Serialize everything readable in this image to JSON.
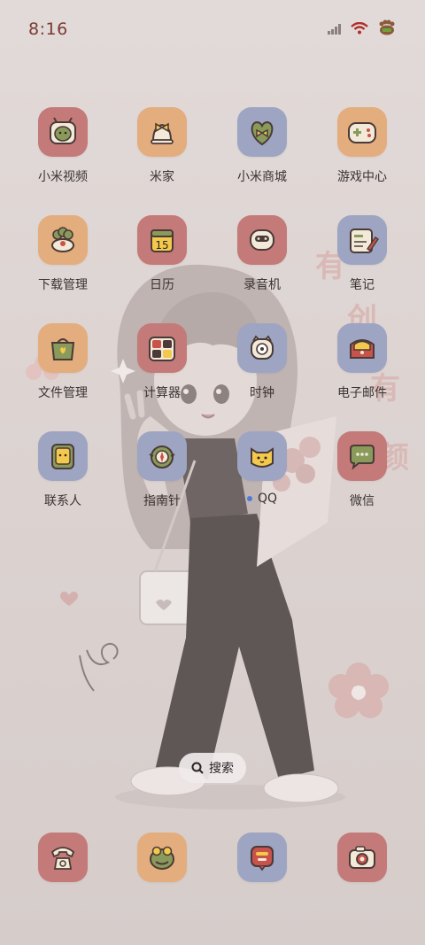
{
  "status_bar": {
    "time": "8:16",
    "icons": [
      "signal-icon",
      "wifi-icon",
      "battery-paw-icon"
    ]
  },
  "apps": [
    {
      "label": "小米视频",
      "icon": "video-cat-icon",
      "color": "#c47a78"
    },
    {
      "label": "米家",
      "icon": "bell-bow-icon",
      "color": "#e4ad7d"
    },
    {
      "label": "小米商城",
      "icon": "heart-bag-icon",
      "color": "#9ea5c2"
    },
    {
      "label": "游戏中心",
      "icon": "gamepad-icon",
      "color": "#e4ad7d"
    },
    {
      "label": "下载管理",
      "icon": "flower-download-icon",
      "color": "#e4ad7d"
    },
    {
      "label": "日历",
      "icon": "calendar-icon",
      "color": "#c47a78",
      "value": "15"
    },
    {
      "label": "录音机",
      "icon": "recorder-icon",
      "color": "#c47a78"
    },
    {
      "label": "笔记",
      "icon": "notepad-icon",
      "color": "#9ea5c2"
    },
    {
      "label": "文件管理",
      "icon": "file-bag-icon",
      "color": "#e4ad7d"
    },
    {
      "label": "计算器",
      "icon": "calculator-icon",
      "color": "#c47a78"
    },
    {
      "label": "时钟",
      "icon": "clock-icon",
      "color": "#9ea5c2"
    },
    {
      "label": "电子邮件",
      "icon": "mail-bag-icon",
      "color": "#9ea5c2"
    },
    {
      "label": "联系人",
      "icon": "contacts-icon",
      "color": "#9ea5c2"
    },
    {
      "label": "指南针",
      "icon": "compass-icon",
      "color": "#9ea5c2"
    },
    {
      "label": "QQ",
      "icon": "qq-cat-icon",
      "color": "#9ea5c2",
      "new_dot": true
    },
    {
      "label": "微信",
      "icon": "chat-bubble-icon",
      "color": "#c47a78"
    }
  ],
  "search": {
    "label": "搜索"
  },
  "dock": [
    {
      "icon": "phone-icon",
      "color": "#c47a78"
    },
    {
      "icon": "messages-frog-icon",
      "color": "#e4ad7d"
    },
    {
      "icon": "message-box-icon",
      "color": "#9ea5c2"
    },
    {
      "icon": "camera-icon",
      "color": "#c47a78"
    }
  ],
  "wallpaper": {
    "text": [
      "有",
      "创",
      "有",
      "颜"
    ]
  }
}
